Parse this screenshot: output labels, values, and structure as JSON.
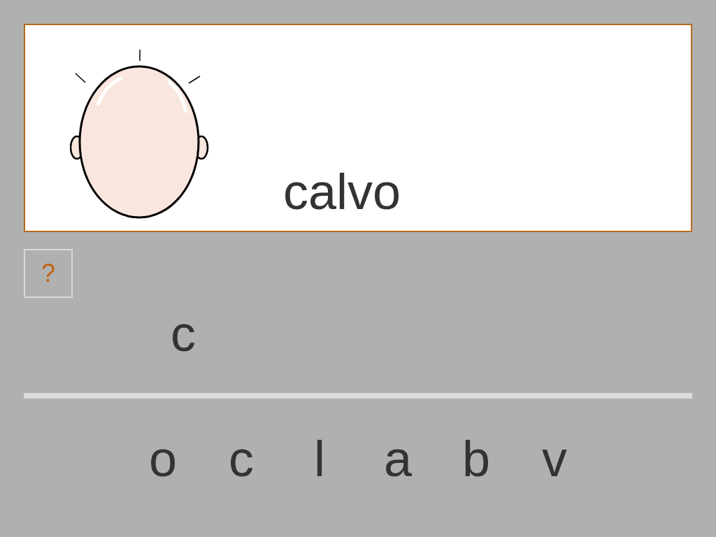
{
  "word": "calvo",
  "help_button": "?",
  "answer": [
    "c"
  ],
  "letters": [
    "o",
    "c",
    "l",
    "a",
    "b",
    "v"
  ]
}
